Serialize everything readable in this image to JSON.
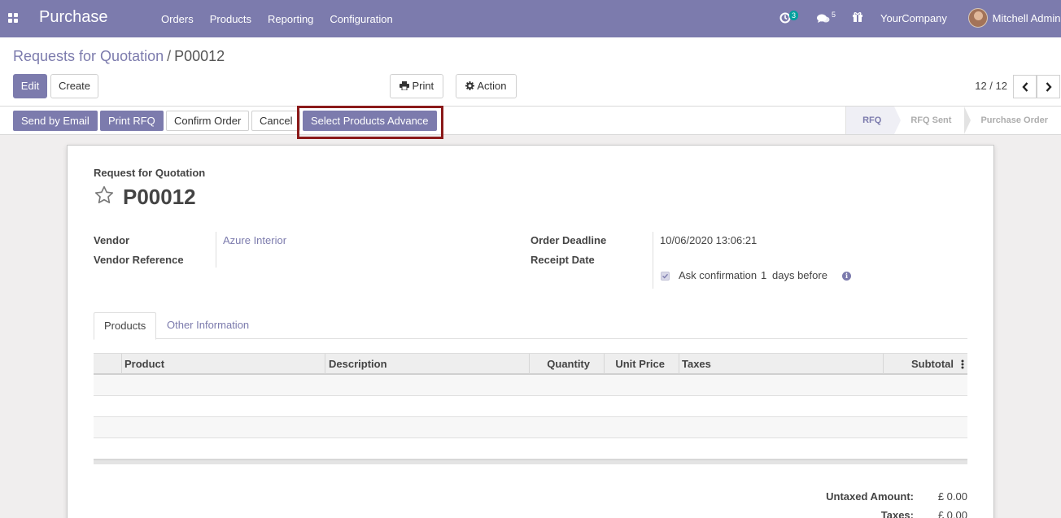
{
  "app": {
    "title": "Purchase"
  },
  "menu": [
    "Orders",
    "Products",
    "Reporting",
    "Configuration"
  ],
  "systray": {
    "activity_count": "3",
    "message_count": "5",
    "company": "YourCompany",
    "user": "Mitchell Admin"
  },
  "breadcrumb": {
    "parent": "Requests for Quotation",
    "separator": "/",
    "current": "P00012"
  },
  "toolbar": {
    "edit": "Edit",
    "create": "Create",
    "print": "Print",
    "action": "Action"
  },
  "pager": {
    "value": "12 / 12"
  },
  "header_buttons": {
    "send_by_email": "Send by Email",
    "print_rfq": "Print RFQ",
    "confirm_order": "Confirm Order",
    "cancel": "Cancel",
    "select_products_advance": "Select Products Advance"
  },
  "stages": [
    "RFQ",
    "RFQ Sent",
    "Purchase Order"
  ],
  "active_stage": "RFQ",
  "form": {
    "doc_type": "Request for Quotation",
    "name": "P00012",
    "vendor_label": "Vendor",
    "vendor_value": "Azure Interior",
    "vendor_ref_label": "Vendor Reference",
    "order_deadline_label": "Order Deadline",
    "order_deadline_value": "10/06/2020 13:06:21",
    "receipt_date_label": "Receipt Date",
    "ask_confirmation_label": "Ask confirmation",
    "ask_confirmation_days": "1",
    "ask_confirmation_suffix": "days before",
    "info_glyph": "i"
  },
  "tabs": [
    "Products",
    "Other Information"
  ],
  "table": {
    "columns": [
      "Product",
      "Description",
      "Quantity",
      "Unit Price",
      "Taxes",
      "Subtotal"
    ]
  },
  "totals": {
    "untaxed_label": "Untaxed Amount:",
    "untaxed_value": "£ 0.00",
    "taxes_label": "Taxes:",
    "taxes_value": "£ 0.00"
  },
  "colors": {
    "brand": "#7c7bad",
    "highlight": "#8b1a1a"
  },
  "icons": [
    "apps-icon",
    "activity-clock-icon",
    "messages-icon",
    "gift-icon",
    "print-icon",
    "gear-icon",
    "chevron-left-icon",
    "chevron-right-icon",
    "star-icon",
    "info-icon",
    "column-options-icon"
  ]
}
